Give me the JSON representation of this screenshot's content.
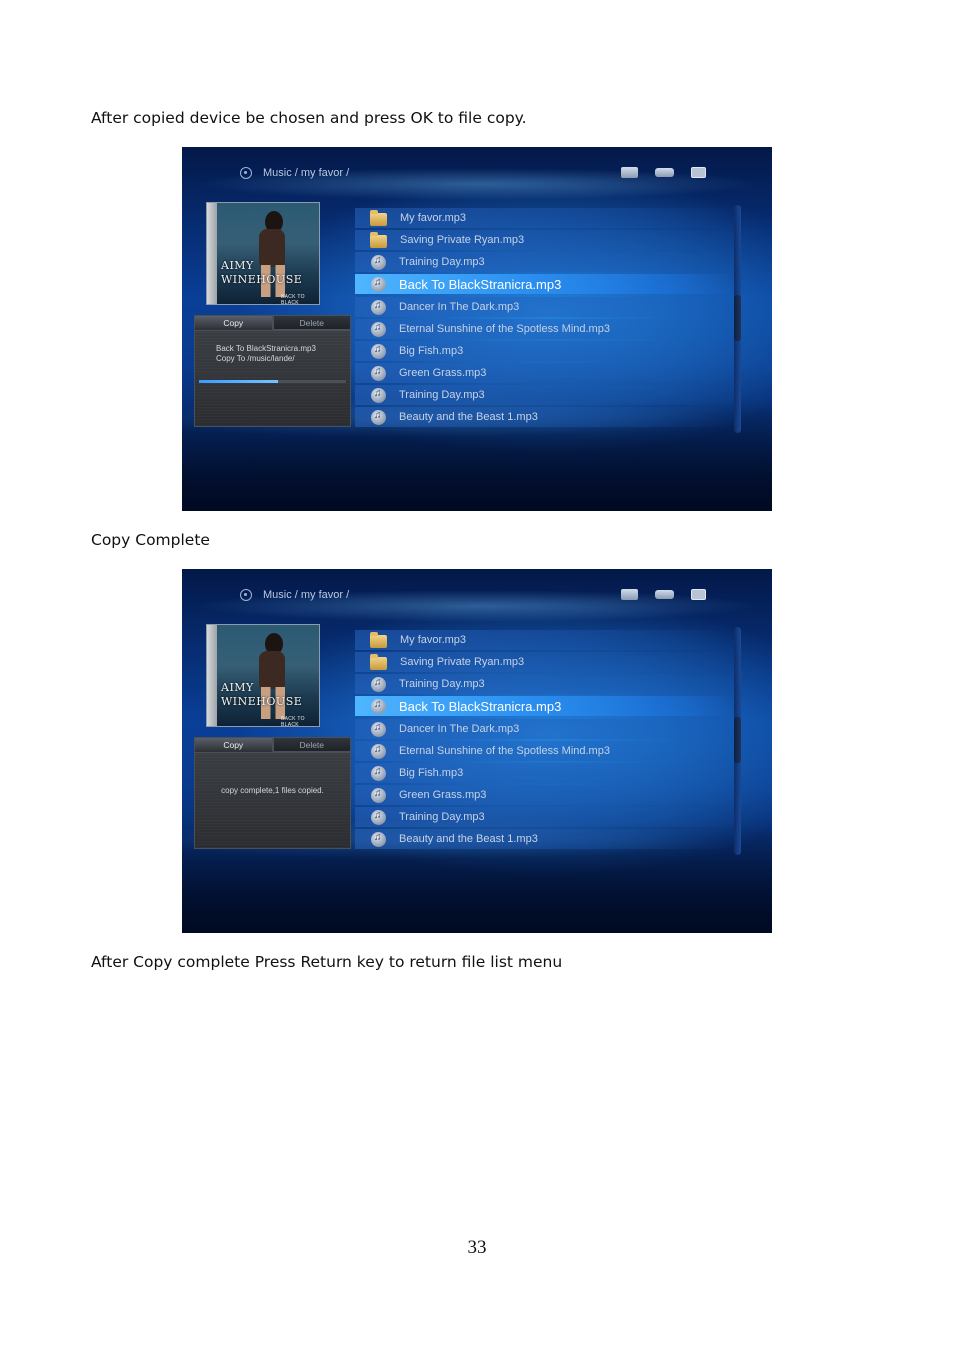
{
  "page": {
    "caption1": "After copied device be  chosen and press OK to file copy.",
    "caption2": "Copy Complete",
    "caption3": "After Copy complete Press Return key to return file list menu",
    "page_number": "33"
  },
  "screen1": {
    "breadcrumb": "Music / my favor /",
    "tab_copy": "Copy",
    "tab_delete": "Delete",
    "message_line1": "Back To BlackStranicra.mp3",
    "message_line2": "Copy To  /music/lande/",
    "progress_fraction": 0.54,
    "album": {
      "artist_line1": "AIMY",
      "artist_line2": "WINEHOUSE",
      "album_title": "BACK TO BLACK"
    },
    "files": [
      {
        "name": "My favor.mp3",
        "icon": "folder-icon"
      },
      {
        "name": "Saving Private Ryan.mp3",
        "icon": "folder-icon"
      },
      {
        "name": "Training Day.mp3",
        "icon": "music-icon"
      },
      {
        "name": "Back To BlackStranicra.mp3",
        "icon": "music-icon",
        "selected": true
      },
      {
        "name": "Dancer In The Dark.mp3",
        "icon": "music-icon"
      },
      {
        "name": "Eternal Sunshine of the Spotless Mind.mp3",
        "icon": "music-icon"
      },
      {
        "name": "Big Fish.mp3",
        "icon": "music-icon"
      },
      {
        "name": "Green Grass.mp3",
        "icon": "music-icon"
      },
      {
        "name": "Training Day.mp3",
        "icon": "music-icon"
      },
      {
        "name": "Beauty and the Beast 1.mp3",
        "icon": "music-icon"
      }
    ]
  },
  "screen2": {
    "breadcrumb": "Music / my favor /",
    "tab_copy": "Copy",
    "tab_delete": "Delete",
    "message": "copy complete,1 files copied.",
    "album": {
      "artist_line1": "AIMY",
      "artist_line2": "WINEHOUSE",
      "album_title": "BACK TO BLACK"
    },
    "files": [
      {
        "name": "My favor.mp3",
        "icon": "folder-icon"
      },
      {
        "name": "Saving Private Ryan.mp3",
        "icon": "folder-icon"
      },
      {
        "name": "Training Day.mp3",
        "icon": "music-icon"
      },
      {
        "name": "Back To BlackStranicra.mp3",
        "icon": "music-icon",
        "selected": true
      },
      {
        "name": "Dancer In The Dark.mp3",
        "icon": "music-icon"
      },
      {
        "name": "Eternal Sunshine of the Spotless Mind.mp3",
        "icon": "music-icon"
      },
      {
        "name": "Big Fish.mp3",
        "icon": "music-icon"
      },
      {
        "name": "Green Grass.mp3",
        "icon": "music-icon"
      },
      {
        "name": "Training Day.mp3",
        "icon": "music-icon"
      },
      {
        "name": "Beauty and the Beast 1.mp3",
        "icon": "music-icon"
      }
    ]
  }
}
